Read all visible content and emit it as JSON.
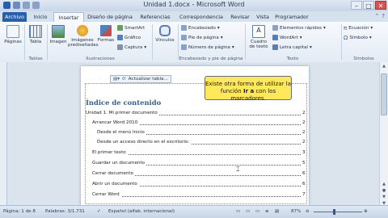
{
  "window": {
    "title": "Unidad 1.docx - Microsoft Word",
    "minimize": "–",
    "maximize": "□",
    "close": "✕"
  },
  "tabs": [
    {
      "label": "Archivo"
    },
    {
      "label": "Inicio"
    },
    {
      "label": "Insertar"
    },
    {
      "label": "Diseño de página"
    },
    {
      "label": "Referencias"
    },
    {
      "label": "Correspondencia"
    },
    {
      "label": "Revisar"
    },
    {
      "label": "Vista"
    },
    {
      "label": "Programador"
    }
  ],
  "active_tab": "Insertar",
  "ribbon": {
    "paginas": "Páginas",
    "tabla": "Tabla",
    "imagen": "Imagen",
    "imagenes_pred": "Imágenes",
    "imagenes_pred2": "prediseñadas",
    "formas": "Formas",
    "smartart": "SmartArt",
    "grafico": "Gráfico",
    "captura": "Captura",
    "vinculos": "Vínculos",
    "encabezado": "Encabezado",
    "pie_pagina": "Pie de página",
    "numero_pagina": "Número de página",
    "cuadro_texto": "Cuadro",
    "cuadro_texto2": "de texto",
    "elementos_rapidos": "Elementos rápidos",
    "wordart": "WordArt",
    "letra_capital": "Letra capital",
    "ecuacion": "Ecuación",
    "simbolo": "Símbolo",
    "groups": {
      "tablas": "Tablas",
      "ilustraciones": "Ilustraciones",
      "encabezado_pie": "Encabezado y pie de página",
      "texto": "Texto",
      "simbolos": "Símbolos"
    }
  },
  "document": {
    "toc_toolbar_label": "Actualizar tabla...",
    "toc_title": "Índice de contenido",
    "toc_entries": [
      {
        "text": "Unidad 1. Mi primer documento",
        "page": "2"
      },
      {
        "text": "Arrancar Word 2010",
        "page": "2"
      },
      {
        "text": "Desde el menú Inicio",
        "page": "2"
      },
      {
        "text": "Desde un acceso directo en el escritorio:",
        "page": "2"
      },
      {
        "text": "El primer texto",
        "page": "3"
      },
      {
        "text": "Guardar un documento",
        "page": "5"
      },
      {
        "text": "Cerrar documento",
        "page": "6"
      },
      {
        "text": "Abrir un documento",
        "page": "6"
      },
      {
        "text": "Cerrar Word",
        "page": "7"
      }
    ]
  },
  "callout": {
    "line1": "Existe otra forma de utilizar la",
    "line2_pre": "función",
    "line2_bold": "Ir a",
    "line2_post": "con los marcadores."
  },
  "status": {
    "page": "Página: 1 de 8",
    "words": "Palabras: 3/1.731",
    "language": "Español (alfab. internacional)",
    "zoom": "87%",
    "zoom_level": 0.87
  }
}
